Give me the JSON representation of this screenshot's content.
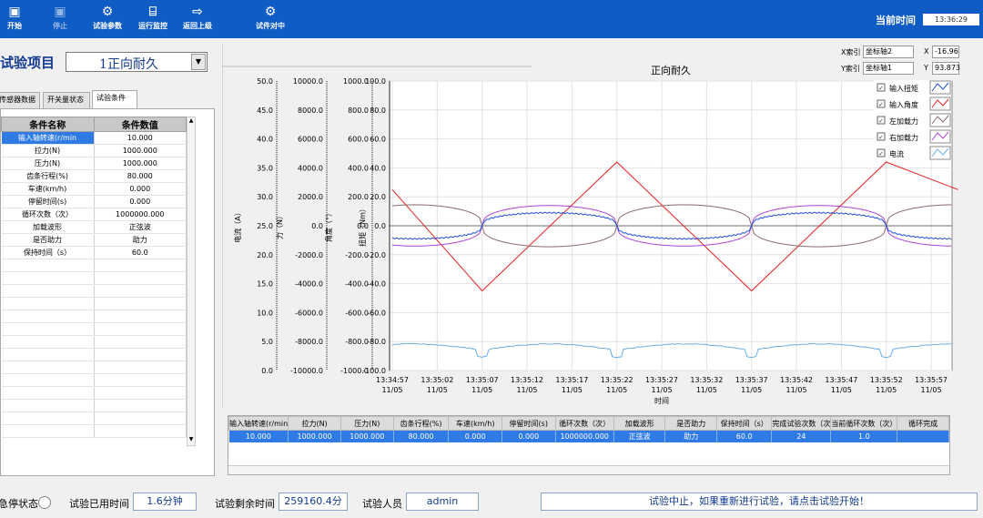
{
  "toolbar": {
    "buttons": [
      {
        "label": "开始",
        "icon": "play-icon"
      },
      {
        "label": "停止",
        "icon": "stop-icon"
      },
      {
        "label": "试验参数",
        "icon": "gears-icon"
      },
      {
        "label": "运行监控",
        "icon": "monitor-icon"
      },
      {
        "label": "返回上级",
        "icon": "exit-icon"
      },
      {
        "label": "试件对中",
        "icon": "gears-icon"
      }
    ],
    "time_label": "当前时间",
    "time_value": "13:36:29"
  },
  "project": {
    "label": "试验项目",
    "value": "1正向耐久"
  },
  "tabs": [
    "传感器数据",
    "开关量状态",
    "试验条件"
  ],
  "param_table": {
    "headers": [
      "条件名称",
      "条件数值"
    ],
    "rows": [
      [
        "输入轴转速(r/min",
        "10.000"
      ],
      [
        "拉力(N)",
        "1000.000"
      ],
      [
        "压力(N)",
        "1000.000"
      ],
      [
        "齿条行程(%)",
        "80.000"
      ],
      [
        "车速(km/h)",
        "0.000"
      ],
      [
        "停留时间(s)",
        "0.000"
      ],
      [
        "循环次数（次）",
        "1000000.000"
      ],
      [
        "加载波形",
        "正弦波"
      ],
      [
        "是否助力",
        "助力"
      ],
      [
        "保持时间（s）",
        "60.0"
      ]
    ]
  },
  "cursor": {
    "x_label": "X索引",
    "x_sel": "坐标轴2",
    "y_label": "Y索引",
    "y_sel": "坐标轴1",
    "x_val_label": "X",
    "x_val": "-16.96",
    "y_val_label": "Y",
    "y_val": "93.873"
  },
  "chart_data": {
    "type": "line",
    "title": "正向耐久",
    "xlabel": "时间",
    "x_ticks": [
      "13:34:57",
      "13:35:02",
      "13:35:07",
      "13:35:12",
      "13:35:17",
      "13:35:22",
      "13:35:27",
      "13:35:32",
      "13:35:37",
      "13:35:42",
      "13:35:47",
      "13:35:52",
      "13:35:57"
    ],
    "x_date": "11/05",
    "axes": [
      {
        "label": "电流（A）",
        "min": 0,
        "max": 50,
        "ticks": [
          "50.0",
          "45.0",
          "40.0",
          "35.0",
          "30.0",
          "25.0",
          "20.0",
          "15.0",
          "10.0",
          "5.0",
          "0.0"
        ]
      },
      {
        "label": "力（N）",
        "min": -10000,
        "max": 10000,
        "ticks": [
          "10000.0",
          "8000.0",
          "6000.0",
          "4000.0",
          "2000.0",
          "0.0",
          "-2000.0",
          "-4000.0",
          "-6000.0",
          "-8000.0",
          "-10000.0"
        ]
      },
      {
        "label": "角度（°）",
        "min": -1000,
        "max": 1000,
        "ticks": [
          "1000.0",
          "800.0",
          "600.0",
          "400.0",
          "200.0",
          "0.0",
          "-200.0",
          "-400.0",
          "-600.0",
          "-800.0",
          "-1000.0"
        ]
      },
      {
        "label": "扭矩（Nm）",
        "min": -100,
        "max": 100,
        "ticks": [
          "100.0",
          "80.0",
          "60.0",
          "40.0",
          "20.0",
          "0.0",
          "-20.0",
          "-40.0",
          "-60.0",
          "-80.0",
          "-100.0"
        ]
      }
    ],
    "legend": [
      {
        "name": "输入扭矩",
        "color": "#1f4fd6"
      },
      {
        "name": "输入角度",
        "color": "#e82020"
      },
      {
        "name": "左加载力",
        "color": "#8a6a6a"
      },
      {
        "name": "右加载力",
        "color": "#b040d8"
      },
      {
        "name": "电流",
        "color": "#6aaee8"
      }
    ],
    "series": [
      {
        "name": "输入角度",
        "axis": "角度（°）",
        "x": [
          0,
          2.5,
          7,
          11.5,
          16,
          20.5,
          25,
          27.7
        ],
        "values": [
          250,
          200,
          -450,
          200,
          450,
          -450,
          450,
          250
        ]
      },
      {
        "name": "左加载力",
        "axis": "力（N）",
        "period": 15,
        "amplitude": 1450
      },
      {
        "name": "右加载力",
        "axis": "力（N）",
        "period": 15,
        "amplitude": 1400
      },
      {
        "name": "输入扭矩",
        "axis": "扭矩（Nm）",
        "period": 15,
        "amplitude": 3
      },
      {
        "name": "电流",
        "axis": "电流（A）",
        "base": 3.5,
        "peak": 4.6,
        "dip": 0.5
      }
    ],
    "grid": true,
    "legend_position": "top-right"
  },
  "bottom_table": {
    "headers": [
      "输入轴转速(r/min",
      "拉力(N)",
      "压力(N)",
      "齿条行程(%)",
      "车速(km/h)",
      "停留时间(s)",
      "循环次数（次）",
      "加载波形",
      "是否助力",
      "保持时间（s）",
      "完成试验次数（次",
      "当前循环次数（次）",
      "循环完成"
    ],
    "row": [
      "10.000",
      "1000.000",
      "1000.000",
      "80.000",
      "0.000",
      "0.000",
      "1000000.000",
      "正弦波",
      "助力",
      "60.0",
      "24",
      "1.0",
      ""
    ]
  },
  "status": {
    "stop_label": "急停状态",
    "used_label": "试验已用时间",
    "used_value": "1.6分钟",
    "remain_label": "试验剩余时间",
    "remain_value": "259160.4分",
    "operator_label": "试验人员",
    "operator_value": "admin",
    "message": "试验中止，如果重新进行试验，请点击试验开始！"
  }
}
